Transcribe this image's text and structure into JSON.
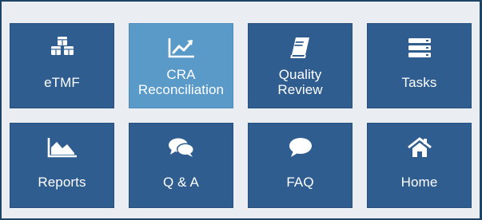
{
  "tiles": [
    {
      "label": "eTMF",
      "icon": "cubes-icon",
      "active": false
    },
    {
      "label": "CRA\nReconciliation",
      "icon": "line-chart-icon",
      "active": true
    },
    {
      "label": "Quality\nReview",
      "icon": "book-icon",
      "active": false
    },
    {
      "label": "Tasks",
      "icon": "tasks-icon",
      "active": false
    },
    {
      "label": "Reports",
      "icon": "area-chart-icon",
      "active": false
    },
    {
      "label": "Q & A",
      "icon": "comments-icon",
      "active": false
    },
    {
      "label": "FAQ",
      "icon": "comment-icon",
      "active": false
    },
    {
      "label": "Home",
      "icon": "home-icon",
      "active": false
    }
  ],
  "colors": {
    "tile": "#2f5d90",
    "tile_active": "#5a9ac9",
    "background": "#eaeef2",
    "frame_border": "#1d4464",
    "text": "#ffffff"
  }
}
